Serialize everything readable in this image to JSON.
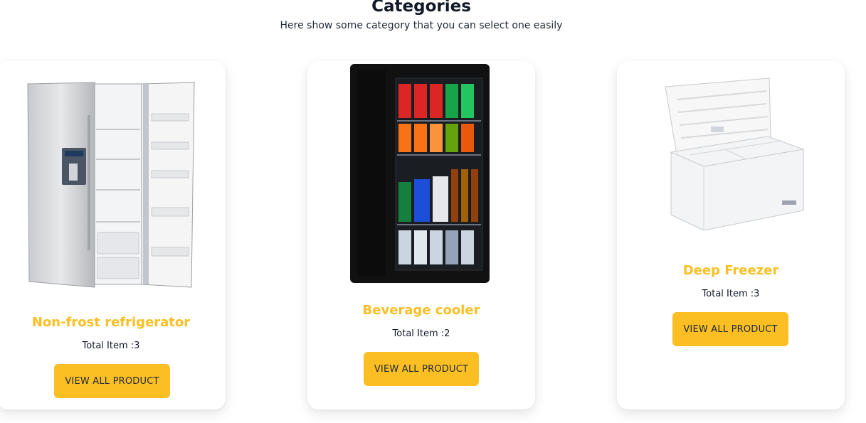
{
  "section": {
    "title": "Categories",
    "subtitle": "Here show some category that you can select one easily"
  },
  "categories": [
    {
      "name": "Non-frost refrigerator",
      "count_label": "Total Item :",
      "count": "3",
      "button_label": "VIEW ALL PRODUCT",
      "image_icon": "side-by-side-refrigerator-image"
    },
    {
      "name": "Beverage cooler",
      "count_label": "Total Item :",
      "count": "2",
      "button_label": "VIEW ALL PRODUCT",
      "image_icon": "beverage-cooler-image"
    },
    {
      "name": "Deep Freezer",
      "count_label": "Total Item :",
      "count": "3",
      "button_label": "VIEW ALL PRODUCT",
      "image_icon": "chest-freezer-image"
    }
  ],
  "colors": {
    "accent": "#fbbf24",
    "heading": "#111827",
    "card_bg": "#ffffff"
  }
}
